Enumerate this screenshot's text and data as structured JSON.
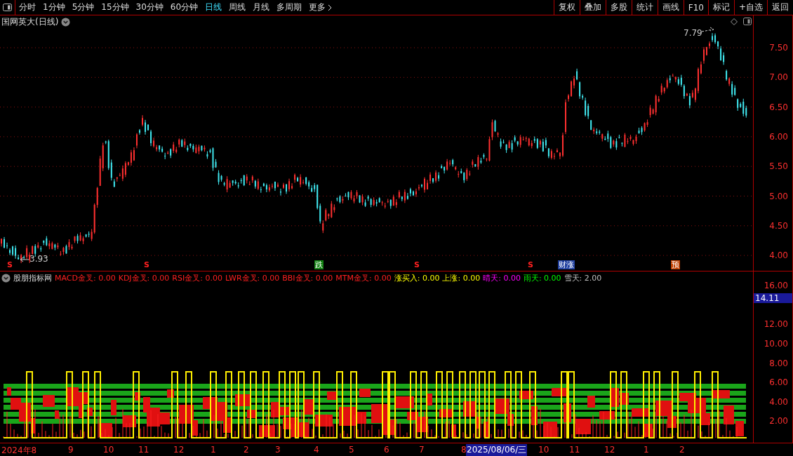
{
  "toolbar": {
    "periods": [
      {
        "label": "分时",
        "selected": false
      },
      {
        "label": "1分钟",
        "selected": false
      },
      {
        "label": "5分钟",
        "selected": false
      },
      {
        "label": "15分钟",
        "selected": false
      },
      {
        "label": "30分钟",
        "selected": false
      },
      {
        "label": "60分钟",
        "selected": false
      },
      {
        "label": "日线",
        "selected": true
      },
      {
        "label": "周线",
        "selected": false
      },
      {
        "label": "月线",
        "selected": false
      },
      {
        "label": "多周期",
        "selected": false
      },
      {
        "label": "更多",
        "selected": false
      }
    ],
    "actions": [
      "复权",
      "叠加",
      "多股",
      "统计",
      "画线",
      "F10",
      "标记",
      "+自选",
      "返回"
    ]
  },
  "main_chart": {
    "title": "国网英大(日线)",
    "price_axis": [
      "7.50",
      "7.00",
      "6.50",
      "6.00",
      "5.50",
      "5.00",
      "4.50",
      "4.00"
    ],
    "high_label": "7.79",
    "low_label": "3.93",
    "markers": [
      {
        "text": "S",
        "kind": "sell"
      },
      {
        "text": "S",
        "kind": "sell"
      },
      {
        "text": "跌",
        "kind": "fall"
      },
      {
        "text": "S",
        "kind": "sell"
      },
      {
        "text": "S",
        "kind": "sell"
      },
      {
        "text": "财涨",
        "kind": "news"
      },
      {
        "text": "预",
        "kind": "forecast"
      }
    ]
  },
  "indicator": {
    "name": "股朋指标网",
    "legend": [
      {
        "label": "MACD金叉:",
        "value": "0.00",
        "color": "#ff2020"
      },
      {
        "label": "KDJ金叉:",
        "value": "0.00",
        "color": "#ff2020"
      },
      {
        "label": "RSI金叉:",
        "value": "0.00",
        "color": "#ff2020"
      },
      {
        "label": "LWR金叉:",
        "value": "0.00",
        "color": "#ff2020"
      },
      {
        "label": "BBI金叉:",
        "value": "0.00",
        "color": "#ff2020"
      },
      {
        "label": "MTM金叉:",
        "value": "0.00",
        "color": "#ff2020"
      },
      {
        "label": "涨买入:",
        "value": "0.00",
        "color": "#ffff00"
      },
      {
        "label": "上涨:",
        "value": "0.00",
        "color": "#ffff00"
      },
      {
        "label": "晴天:",
        "value": "0.00",
        "color": "#ff00ff"
      },
      {
        "label": "雨天:",
        "value": "0.00",
        "color": "#00ff00"
      },
      {
        "label": "雪天:",
        "value": "2.00",
        "color": "#c0c0c0"
      }
    ],
    "axis": [
      {
        "label": "16.00",
        "selected": false
      },
      {
        "label": "14.11",
        "selected": true
      },
      {
        "label": "12.00",
        "selected": false
      },
      {
        "label": "10.00",
        "selected": false
      },
      {
        "label": "8.00",
        "selected": false
      },
      {
        "label": "6.00",
        "selected": false
      },
      {
        "label": "4.00",
        "selected": false
      },
      {
        "label": "2.00",
        "selected": false
      }
    ]
  },
  "date_axis": [
    {
      "label": "2024年8",
      "selected": false
    },
    {
      "label": "9",
      "selected": false
    },
    {
      "label": "10",
      "selected": false
    },
    {
      "label": "11",
      "selected": false
    },
    {
      "label": "12",
      "selected": false
    },
    {
      "label": "1",
      "selected": false
    },
    {
      "label": "2",
      "selected": false
    },
    {
      "label": "3",
      "selected": false
    },
    {
      "label": "4",
      "selected": false
    },
    {
      "label": "5",
      "selected": false
    },
    {
      "label": "6",
      "selected": false
    },
    {
      "label": "7",
      "selected": false
    },
    {
      "label": "8",
      "selected": false
    },
    {
      "label": "2025/08/06/三",
      "selected": true
    },
    {
      "label": "10",
      "selected": false
    },
    {
      "label": "11",
      "selected": false
    },
    {
      "label": "12",
      "selected": false
    },
    {
      "label": "1",
      "selected": false
    },
    {
      "label": "2",
      "selected": false
    }
  ]
}
